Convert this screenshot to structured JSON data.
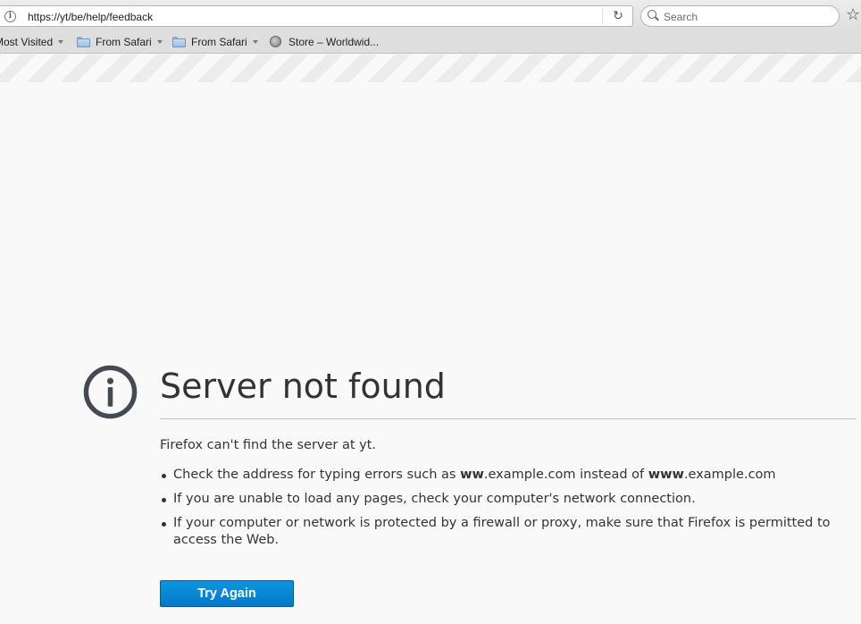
{
  "browser": {
    "url": "https://yt/be/help/feedback",
    "search_placeholder": "Search",
    "bookmarks": [
      {
        "label": "Most Visited",
        "type": "menu"
      },
      {
        "label": "From Safari",
        "type": "folder"
      },
      {
        "label": "From Safari",
        "type": "folder"
      },
      {
        "label": "Store – Worldwid...",
        "type": "link"
      }
    ]
  },
  "error": {
    "title": "Server not found",
    "description": "Firefox can't find the server at yt.",
    "suggestions": {
      "s1_pre": "Check the address for typing errors such as ",
      "s1_bad_bold": "ww",
      "s1_bad_rest": ".example.com instead of ",
      "s1_good_bold": "www",
      "s1_good_rest": ".example.com",
      "s2": "If you are unable to load any pages, check your computer's network connection.",
      "s3": "If your computer or network is protected by a firewall or proxy, make sure that Firefox is permitted to access the Web."
    },
    "try_again_label": "Try Again"
  },
  "colors": {
    "accent": "#0a95e0",
    "page_background": "#f9f9fa",
    "icon": "#444a53"
  },
  "icons": [
    "info-icon",
    "reload-icon",
    "search-icon",
    "star-icon",
    "folder-icon",
    "globe-icon",
    "error-info-icon"
  ]
}
